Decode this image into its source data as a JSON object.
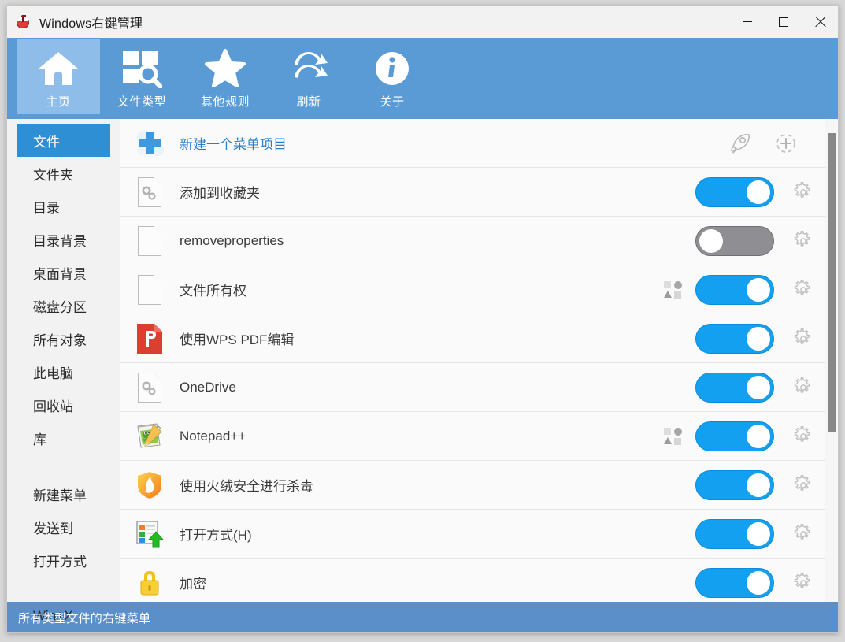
{
  "window": {
    "title": "Windows右键管理",
    "app_icon": "mouse-icon",
    "controls": {
      "minimize": "minimize-icon",
      "maximize": "maximize-icon",
      "close": "close-icon"
    }
  },
  "colors": {
    "toolbar_blue": "#5b9bd5",
    "toolbar_active": "#8fbde9",
    "sidebar_active": "#2e8fd4",
    "toggle_on": "#14a0f0",
    "toggle_off": "#8e8e93",
    "statusbar": "#5b8fc9",
    "link": "#2a7fc9"
  },
  "toolbar": {
    "items": [
      {
        "label": "主页",
        "icon": "home-icon",
        "active": true
      },
      {
        "label": "文件类型",
        "icon": "filetype-search-icon",
        "active": false
      },
      {
        "label": "其他规则",
        "icon": "star-icon",
        "active": false
      },
      {
        "label": "刷新",
        "icon": "refresh-icon",
        "active": false
      },
      {
        "label": "关于",
        "icon": "info-icon",
        "active": false
      }
    ]
  },
  "sidebar": {
    "group1": [
      {
        "label": "文件",
        "active": true
      },
      {
        "label": "文件夹",
        "active": false
      },
      {
        "label": "目录",
        "active": false
      },
      {
        "label": "目录背景",
        "active": false
      },
      {
        "label": "桌面背景",
        "active": false
      },
      {
        "label": "磁盘分区",
        "active": false
      },
      {
        "label": "所有对象",
        "active": false
      },
      {
        "label": "此电脑",
        "active": false
      },
      {
        "label": "回收站",
        "active": false
      },
      {
        "label": "库",
        "active": false
      }
    ],
    "group2": [
      {
        "label": "新建菜单",
        "active": false
      },
      {
        "label": "发送到",
        "active": false
      },
      {
        "label": "打开方式",
        "active": false
      }
    ],
    "group3": [
      {
        "label": "Win+X",
        "active": false
      }
    ]
  },
  "list": {
    "new_item": {
      "label": "新建一个菜单项目",
      "icon": "plus-add-icon",
      "rocket_icon": "rocket-icon",
      "add_circle_icon": "add-circle-dashed-icon"
    },
    "rows": [
      {
        "label": "添加到收藏夹",
        "icon": "doc-gears-icon",
        "toggle": "on",
        "badge": false,
        "gear": true
      },
      {
        "label": "removeproperties",
        "icon": "doc-blank-icon",
        "toggle": "off",
        "badge": false,
        "gear": true
      },
      {
        "label": "文件所有权",
        "icon": "doc-blank-icon",
        "toggle": "on",
        "badge": true,
        "gear": true
      },
      {
        "label": "使用WPS PDF编辑",
        "icon": "wps-pdf-icon",
        "toggle": "on",
        "badge": false,
        "gear": true
      },
      {
        "label": "OneDrive",
        "icon": "doc-gears-icon",
        "toggle": "on",
        "badge": false,
        "gear": true
      },
      {
        "label": "Notepad++",
        "icon": "notepadpp-icon",
        "toggle": "on",
        "badge": true,
        "gear": true
      },
      {
        "label": "使用火绒安全进行杀毒",
        "icon": "huorong-shield-icon",
        "toggle": "on",
        "badge": false,
        "gear": true
      },
      {
        "label": "打开方式(H)",
        "icon": "open-with-icon",
        "toggle": "on",
        "badge": false,
        "gear": true
      },
      {
        "label": "加密",
        "icon": "lock-icon",
        "toggle": "on",
        "badge": false,
        "gear": true
      }
    ]
  },
  "scrollbar": {
    "thumb_top_pct": 3,
    "thumb_height_pct": 62
  },
  "statusbar": {
    "text": "所有类型文件的右键菜单"
  }
}
